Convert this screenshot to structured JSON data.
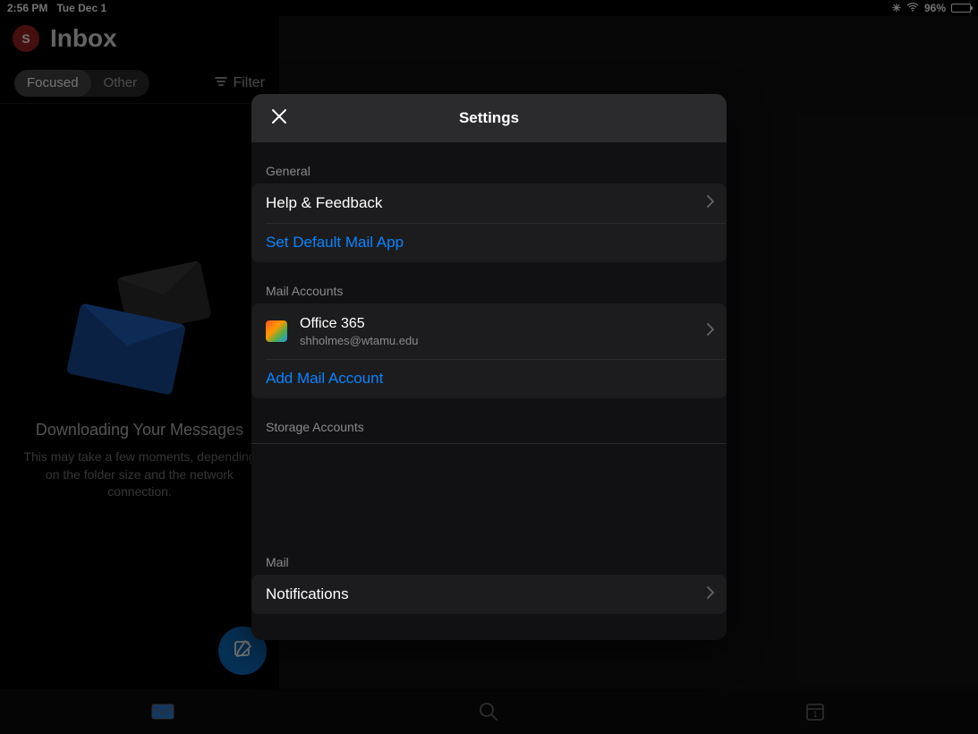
{
  "statusbar": {
    "time": "2:56 PM",
    "date": "Tue Dec 1",
    "battery_pct": "96%"
  },
  "header": {
    "avatar_initial": "S",
    "title": "Inbox"
  },
  "toolbar": {
    "focused": "Focused",
    "other": "Other",
    "filter": "Filter"
  },
  "emptystate": {
    "title": "Downloading Your Messages",
    "subtitle": "This may take a few moments, depending on the folder size and the network connection."
  },
  "modal": {
    "title": "Settings",
    "sections": {
      "general_label": "General",
      "help_feedback": "Help & Feedback",
      "set_default": "Set Default Mail App",
      "mail_accounts_label": "Mail Accounts",
      "account_name": "Office 365",
      "account_email": "shholmes@wtamu.edu",
      "add_account": "Add Mail Account",
      "storage_label": "Storage Accounts",
      "mail_label": "Mail",
      "notifications": "Notifications"
    }
  },
  "colors": {
    "accent": "#0a84ff",
    "row_bg": "#1c1c1e"
  }
}
